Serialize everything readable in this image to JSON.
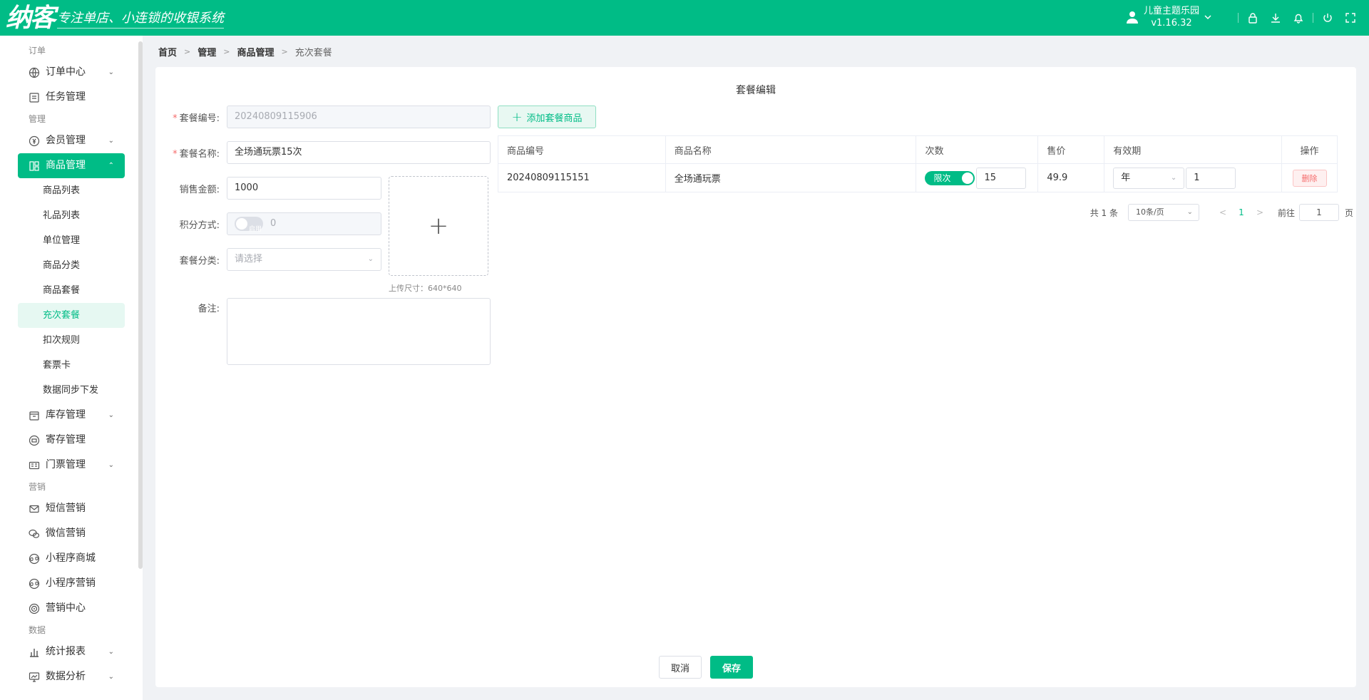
{
  "header": {
    "logo_main": "纳客",
    "logo_slogan": "专注单店、小连锁的收银系统",
    "store_name": "儿童主题乐园",
    "version": "v1.16.32"
  },
  "sidebar": {
    "group_order": "订单",
    "order_center": "订单中心",
    "task_mgmt": "任务管理",
    "group_manage": "管理",
    "member_mgmt": "会员管理",
    "goods_mgmt": "商品管理",
    "goods_sub": [
      "商品列表",
      "礼品列表",
      "单位管理",
      "商品分类",
      "商品套餐",
      "充次套餐",
      "扣次规则",
      "套票卡",
      "数据同步下发"
    ],
    "stock_mgmt": "库存管理",
    "deposit_mgmt": "寄存管理",
    "ticket_mgmt": "门票管理",
    "group_marketing": "营销",
    "sms_marketing": "短信营销",
    "wechat_marketing": "微信营销",
    "mini_mall": "小程序商城",
    "mini_marketing": "小程序营销",
    "marketing_center": "营销中心",
    "group_data": "数据",
    "stat_report": "统计报表",
    "data_analysis": "数据分析"
  },
  "breadcrumb": [
    "首页",
    "管理",
    "商品管理",
    "充次套餐"
  ],
  "form": {
    "title": "套餐编辑",
    "code_label": "套餐编号:",
    "code_value": "20240809115906",
    "name_label": "套餐名称:",
    "name_value": "全场通玩票15次",
    "price_label": "销售金额:",
    "price_value": "1000",
    "points_label": "积分方式:",
    "points_switch": "启用",
    "points_value": "0",
    "category_label": "套餐分类:",
    "category_placeholder": "请选择",
    "upload_plus": "+",
    "upload_hint": "上传尺寸：640*640",
    "remark_label": "备注:"
  },
  "table": {
    "add_button": "添加套餐商品",
    "columns": [
      "商品编号",
      "商品名称",
      "次数",
      "售价",
      "有效期",
      "操作"
    ],
    "rows": [
      {
        "code": "20240809115151",
        "name": "全场通玩票",
        "limit_label": "限次",
        "count": "15",
        "price": "49.9",
        "period_unit": "年",
        "period_value": "1",
        "action": "删除"
      }
    ]
  },
  "pager": {
    "total": "共 1 条",
    "page_size": "10条/页",
    "current": "1",
    "jump_label": "前往",
    "jump_value": "1",
    "jump_suffix": "页"
  },
  "footer": {
    "cancel": "取消",
    "save": "保存"
  },
  "colors": {
    "primary": "#00bc86",
    "danger": "#f56c6c"
  }
}
